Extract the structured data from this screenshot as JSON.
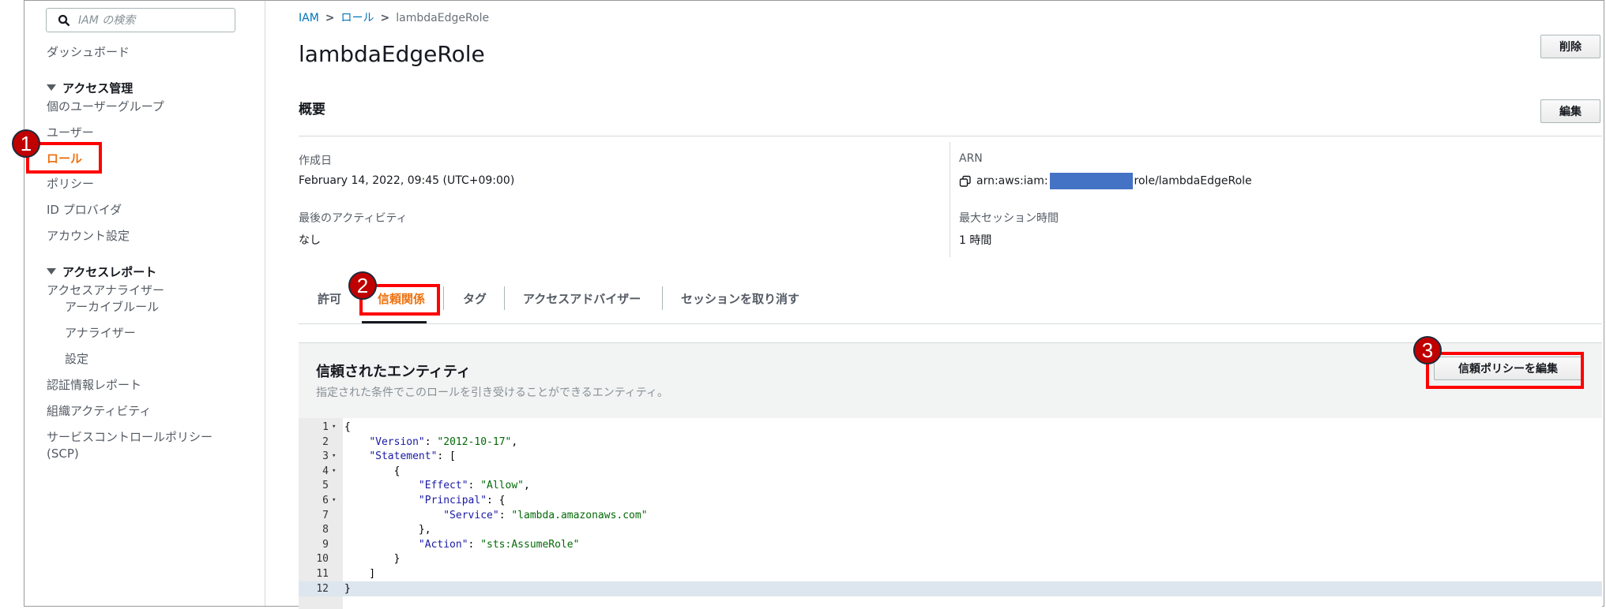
{
  "sidebar": {
    "search_placeholder": "IAM の検索",
    "dashboard": "ダッシュボード",
    "access_management": "アクセス管理",
    "user_groups": "個のユーザーグループ",
    "users": "ユーザー",
    "roles": "ロール",
    "policies": "ポリシー",
    "identity_providers": "ID プロバイダ",
    "account_settings": "アカウント設定",
    "access_reports": "アクセスレポート",
    "access_analyzer": "アクセスアナライザー",
    "archive_rules": "アーカイブルール",
    "analyzers": "アナライザー",
    "settings": "設定",
    "credential_report": "認証情報レポート",
    "org_activity": "組織アクティビティ",
    "scp_line1": "サービスコントロールポリシー",
    "scp_line2": "(SCP)"
  },
  "breadcrumb": {
    "root": "IAM",
    "roles": "ロール",
    "current": "lambdaEdgeRole"
  },
  "page": {
    "title": "lambdaEdgeRole",
    "delete_label": "削除",
    "summary_title": "概要",
    "edit_label": "編集"
  },
  "summary": {
    "created_label": "作成日",
    "created_value": "February 14, 2022, 09:45 (UTC+09:00)",
    "last_activity_label": "最後のアクティビティ",
    "last_activity_value": "なし",
    "arn_label": "ARN",
    "arn_prefix": "arn:aws:iam:",
    "arn_suffix": "role/lambdaEdgeRole",
    "max_session_label": "最大セッション時間",
    "max_session_value": "1 時間"
  },
  "tabs": [
    "許可",
    "信頼関係",
    "タグ",
    "アクセスアドバイザー",
    "セッションを取り消す"
  ],
  "trusted": {
    "title": "信頼されたエンティティ",
    "description": "指定された条件でこのロールを引き受けることができるエンティティ。",
    "edit_button": "信頼ポリシーを編集"
  },
  "code_lines": [
    "{",
    "    \"Version\": \"2012-10-17\",",
    "    \"Statement\": [",
    "        {",
    "            \"Effect\": \"Allow\",",
    "            \"Principal\": {",
    "                \"Service\": \"lambda.amazonaws.com\"",
    "            },",
    "            \"Action\": \"sts:AssumeRole\"",
    "        }",
    "    ]",
    "}"
  ],
  "annotations": [
    "1",
    "2",
    "3"
  ],
  "colors": {
    "accent": "#ec7211",
    "link": "#0073bb",
    "highlight": "#ff0000",
    "badge": "#c00000"
  }
}
